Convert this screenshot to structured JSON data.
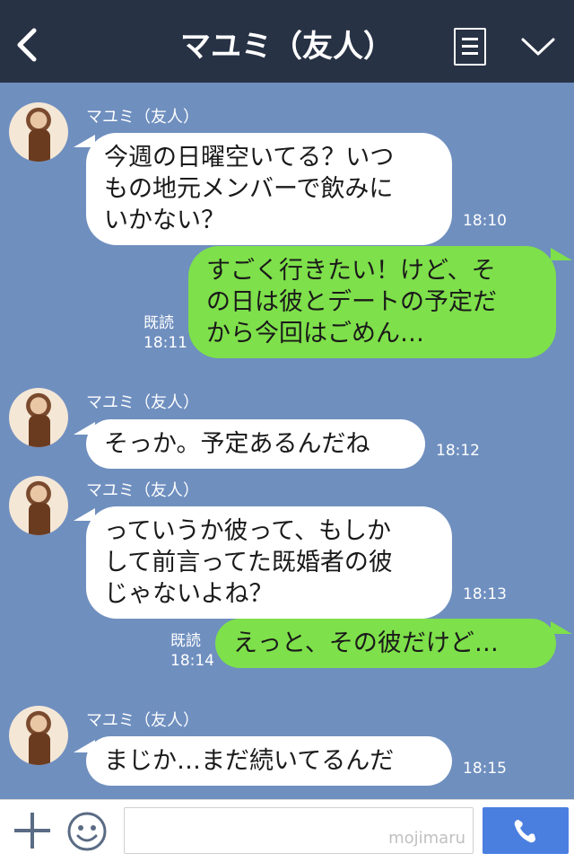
{
  "header": {
    "title": "マユミ（友人）"
  },
  "messages": [
    {
      "sender": "マユミ（友人）",
      "text": "今週の日曜空いてる？いつ\nもの地元メンバーで飲みに\nいかない？",
      "time": "18:10"
    },
    {
      "text": "すごく行きたい！けど、そ\nの日は彼とデートの予定だ\nから今回はごめん…",
      "read": "既読",
      "time": "18:11"
    },
    {
      "sender": "マユミ（友人）",
      "text": "そっか。予定あるんだね",
      "time": "18:12"
    },
    {
      "sender": "マユミ（友人）",
      "text": "っていうか彼って、もしか\nして前言ってた既婚者の彼\nじゃないよね？",
      "time": "18:13"
    },
    {
      "text": "えっと、その彼だけど…",
      "read": "既読",
      "time": "18:14"
    },
    {
      "sender": "マユミ（友人）",
      "text": "まじか…まだ続いてるんだ",
      "time": "18:15"
    }
  ],
  "footer": {
    "watermark": "mojimaru"
  },
  "colors": {
    "header_bg": "#283245",
    "chat_bg": "#6f8fbf",
    "outgoing_bubble": "#7ee04a",
    "incoming_bubble": "#ffffff",
    "send_button": "#4a7fe0"
  }
}
